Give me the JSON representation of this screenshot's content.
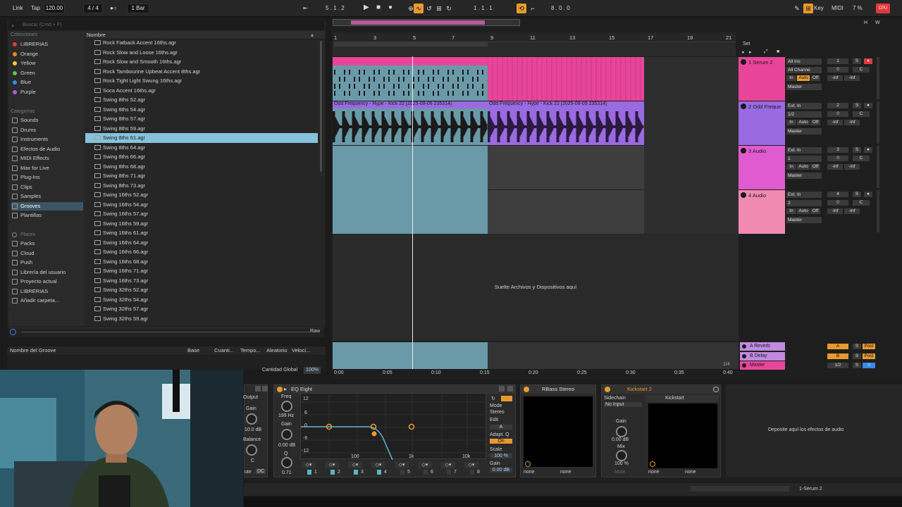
{
  "topbar": {
    "link": "Link",
    "tap": "Tap",
    "tempo": "120.00",
    "signature": "4 / 4",
    "metronome": "1 Bar",
    "position": "5 . 1 . 2",
    "loop_start": "1 . 1 . 1",
    "loop_length": "8 . 0 . 0",
    "key": "Key",
    "midi": "MIDI",
    "cpu": "7 %",
    "cpu_label": "CPU"
  },
  "browser": {
    "search_placeholder": "Buscar (Cmd + F)",
    "column_name": "Nombre",
    "collections_head": "Colecciones",
    "collections": [
      {
        "label": "LIBRERIAS",
        "color": "#e03a3a"
      },
      {
        "label": "Orange",
        "color": "#f08a2a"
      },
      {
        "label": "Yellow",
        "color": "#e8d23a"
      },
      {
        "label": "Green",
        "color": "#58c84a"
      },
      {
        "label": "Blue",
        "color": "#3a8ae8"
      },
      {
        "label": "Purple",
        "color": "#b05ae0"
      }
    ],
    "categories_head": "Categorías",
    "categories": [
      "Sounds",
      "Drums",
      "Instruments",
      "Efectos de Audio",
      "MIDI Effects",
      "Max for Live",
      "Plug-Ins",
      "Clips",
      "Samples",
      "Grooves",
      "Plantillas"
    ],
    "selected_category": "Grooves",
    "places_head": "Places",
    "places": [
      "Packs",
      "Cloud",
      "Push",
      "Librería del usuario",
      "Proyecto actual",
      "LIBRERIAS",
      "Añadir carpeta..."
    ],
    "files": [
      "Rock Fatback Accent 16ths.agr",
      "Rock Slow and Loose 16ths.agr",
      "Rock Slow and Smooth 16ths.agr",
      "Rock Tambourine Upbeat Accent 8ths.agr",
      "Rock Tight Light Swung 16ths.agr",
      "Soca Accent 16ths.agr",
      "Swing 8ths 52.agr",
      "Swing 8ths 54.agr",
      "Swing 8ths 57.agr",
      "Swing 8ths 59.agr",
      "Swing 8ths 61.agr",
      "Swing 8ths 64.agr",
      "Swing 8ths 66.agr",
      "Swing 8ths 68.agr",
      "Swing 8ths 71.agr",
      "Swing 8ths 73.agr",
      "Swing 16ths 52.agr",
      "Swing 16ths 54.agr",
      "Swing 16ths 57.agr",
      "Swing 16ths 59.agr",
      "Swing 16ths 61.agr",
      "Swing 16ths 64.agr",
      "Swing 16ths 66.agr",
      "Swing 16ths 68.agr",
      "Swing 16ths 71.agr",
      "Swing 16ths 73.agr",
      "Swing 32ths 52.agr",
      "Swing 32ths 54.agr",
      "Swing 32ths 57.agr",
      "Swing 32ths 59.agr"
    ],
    "selected_file": "Swing 8ths 61.agr",
    "raw": "Raw"
  },
  "groove_pool": {
    "columns": [
      "Nombre del Groove",
      "Base",
      "Cuanti...",
      "Tempo...",
      "Aleatorio",
      "Veloci..."
    ],
    "global_label": "Cantidad Global",
    "global_value": "100%"
  },
  "arrangement": {
    "bars": [
      "1",
      "3",
      "5",
      "7",
      "9",
      "11",
      "13",
      "15",
      "17",
      "19",
      "21"
    ],
    "set_label": "Set",
    "drop_text": "Suelte Archivos y Dispositivos aquí",
    "clip_label": "Odd Frequency - Hype - Kick 22 [2025-09-09 235314]",
    "times": [
      "0:00",
      "0:05",
      "0:10",
      "0:15",
      "0:20",
      "0:25",
      "0:30",
      "0:35",
      "0:40"
    ],
    "zoom": "1/4"
  },
  "tracks": [
    {
      "name": "1 Serum 2",
      "color": "#e8459a",
      "input": "All Ins",
      "channel": "All Channe",
      "out": "Master",
      "num": "1",
      "vol": "0",
      "pan": "C",
      "inf1": "-inf",
      "inf2": "-inf"
    },
    {
      "name": "2 Odd Freque",
      "color": "#9a6ae0",
      "input": "Ext. In",
      "channel": "1/2",
      "out": "Master",
      "num": "2",
      "vol": "0",
      "pan": "C",
      "inf1": "-inf",
      "inf2": "-inf"
    },
    {
      "name": "3 Audio",
      "color": "#e05ad0",
      "input": "Ext. In",
      "channel": "1",
      "out": "Master",
      "num": "3",
      "vol": "0",
      "pan": "C",
      "inf1": "-inf",
      "inf2": "-inf"
    },
    {
      "name": "4 Audio",
      "color": "#f08ab0",
      "input": "Ext. In",
      "channel": "2",
      "out": "Master",
      "num": "4",
      "vol": "0",
      "pan": "C",
      "inf1": "-inf",
      "inf2": "-inf"
    }
  ],
  "monitor": {
    "in": "In",
    "auto": "Auto",
    "off": "Off"
  },
  "returns": [
    {
      "name": "A Reverb",
      "color": "#c08ae0",
      "letter": "A",
      "mode": "Post"
    },
    {
      "name": "B Delay",
      "color": "#c08ae0",
      "letter": "B",
      "mode": "Post"
    },
    {
      "name": "Master",
      "color": "#e8459a",
      "letter": "1/2",
      "mode": "0"
    }
  ],
  "devices": {
    "output_label": "Output",
    "gain_label": "Gain",
    "gain_value": "10.0 dB",
    "balance_label": "Balance",
    "balance_value": "C",
    "mute_label": "ute",
    "dc_label": "DC",
    "eq_title": "EQ Eight",
    "freq_label": "Freq",
    "freq_value": "199 Hz",
    "eq_gain_label": "Gain",
    "eq_gain_value": "0.00 dB",
    "q_label": "Q",
    "q_value": "0.71",
    "eq_db_marks": [
      "12",
      "6",
      "0",
      "-6",
      "-12"
    ],
    "eq_freq_marks": [
      "100",
      "1k",
      "10k"
    ],
    "mode_label": "Mode",
    "mode_value": "Stereo",
    "edit_label": "Edit",
    "edit_value": "A",
    "adapt_label": "Adapt. Q",
    "adapt_value": "On",
    "scale_label": "Scale",
    "scale_value": "100 %",
    "eq_out_gain_label": "Gain",
    "eq_out_gain_value": "0.00 dB",
    "bands": [
      "1",
      "2",
      "3",
      "4",
      "5",
      "6",
      "7",
      "8"
    ],
    "rbass_title": "RBass Stereo",
    "rbass_none1": "none",
    "rbass_none2": "none",
    "kick_title": "Kickstart 2",
    "sidechain_label": "Sidechain",
    "sidechain_value": "No Input",
    "kick_gain_label": "Gain",
    "kick_gain_value": "0.00 dB",
    "kick_mix_label": "Mix",
    "kick_mix_value": "100 %",
    "kick_mute": "Mute",
    "kick_inner": "Kickstart",
    "kick_none1": "none",
    "kick_none2": "none",
    "drop_effects": "Deposite aquí los efectos de audio"
  },
  "status": {
    "track": "1-Serum 2"
  }
}
